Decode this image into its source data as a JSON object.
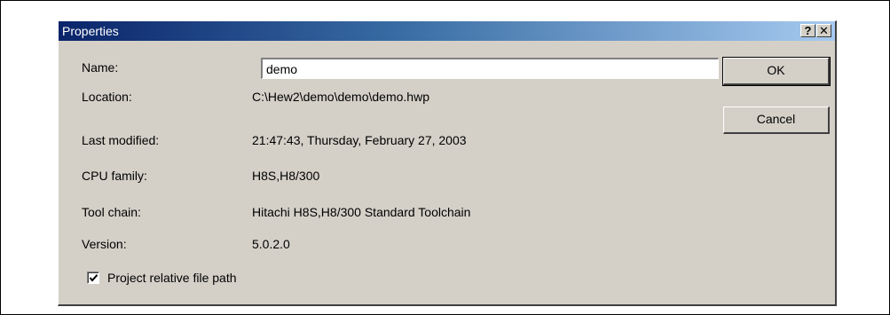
{
  "window": {
    "title": "Properties",
    "help_label": "?",
    "close_label": "✕"
  },
  "fields": {
    "name_label": "Name:",
    "name_value": "demo",
    "location_label": "Location:",
    "location_value": "C:\\Hew2\\demo\\demo\\demo.hwp",
    "last_modified_label": "Last modified:",
    "last_modified_value": "21:47:43, Thursday, February 27, 2003",
    "cpu_family_label": "CPU family:",
    "cpu_family_value": "H8S,H8/300",
    "tool_chain_label": "Tool chain:",
    "tool_chain_value": "Hitachi H8S,H8/300 Standard Toolchain",
    "version_label": "Version:",
    "version_value": "5.0.2.0"
  },
  "buttons": {
    "ok_label": "OK",
    "cancel_label": "Cancel"
  },
  "options": {
    "relative_path_label": "Project relative file path",
    "relative_path_checked": true
  },
  "colors": {
    "titlebar_start": "#0a246a",
    "titlebar_end": "#a6caf0",
    "dialog_face": "#d4d0c8"
  }
}
